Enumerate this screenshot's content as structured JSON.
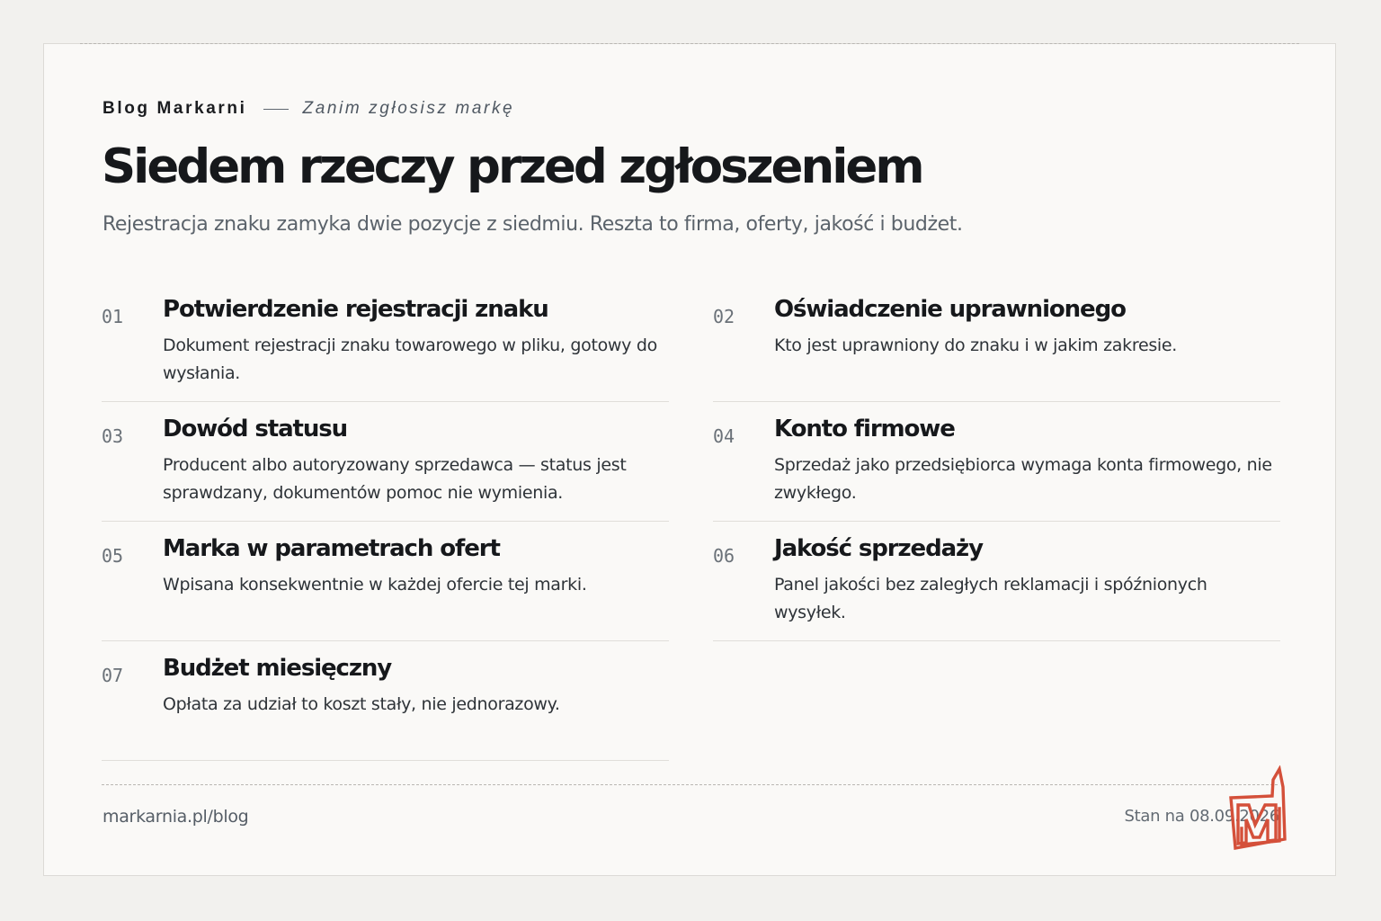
{
  "header": {
    "brand": "Blog Markarni",
    "topic": "Zanim zgłosisz markę",
    "title": "Siedem rzeczy przed zgłoszeniem",
    "subtitle": "Rejestracja znaku zamyka dwie pozycje z siedmiu. Reszta to firma, oferty, jakość i budżet."
  },
  "items": [
    {
      "number": "01",
      "title": "Potwierdzenie rejestracji znaku",
      "description": "Dokument rejestracji znaku towarowego w pliku, gotowy do wysłania."
    },
    {
      "number": "02",
      "title": "Oświadczenie uprawnionego",
      "description": "Kto jest uprawniony do znaku i w jakim zakresie."
    },
    {
      "number": "03",
      "title": "Dowód statusu",
      "description": "Producent albo autoryzowany sprzedawca — status jest sprawdzany, dokumentów pomoc nie wymienia."
    },
    {
      "number": "04",
      "title": "Konto firmowe",
      "description": "Sprzedaż jako przedsiębiorca wymaga konta firmowego, nie zwykłego."
    },
    {
      "number": "05",
      "title": "Marka w parametrach ofert",
      "description": "Wpisana konsekwentnie w każdej ofercie tej marki."
    },
    {
      "number": "06",
      "title": "Jakość sprzedaży",
      "description": "Panel jakości bez zaległych reklamacji i spóźnionych wysyłek."
    },
    {
      "number": "07",
      "title": "Budżet miesięczny",
      "description": "Opłata za udział to koszt stały, nie jednorazowy."
    }
  ],
  "footer": {
    "url": "markarnia.pl/blog",
    "date_prefix": "Stan na",
    "date": "08.09.2026"
  },
  "logo": {
    "icon": "markarnia-m-logo-icon",
    "color": "#d4503a"
  },
  "colors": {
    "background": "#f2f1ee",
    "card": "#faf9f7",
    "text": "#16181b",
    "muted": "#5b636b",
    "accent": "#d4503a"
  }
}
